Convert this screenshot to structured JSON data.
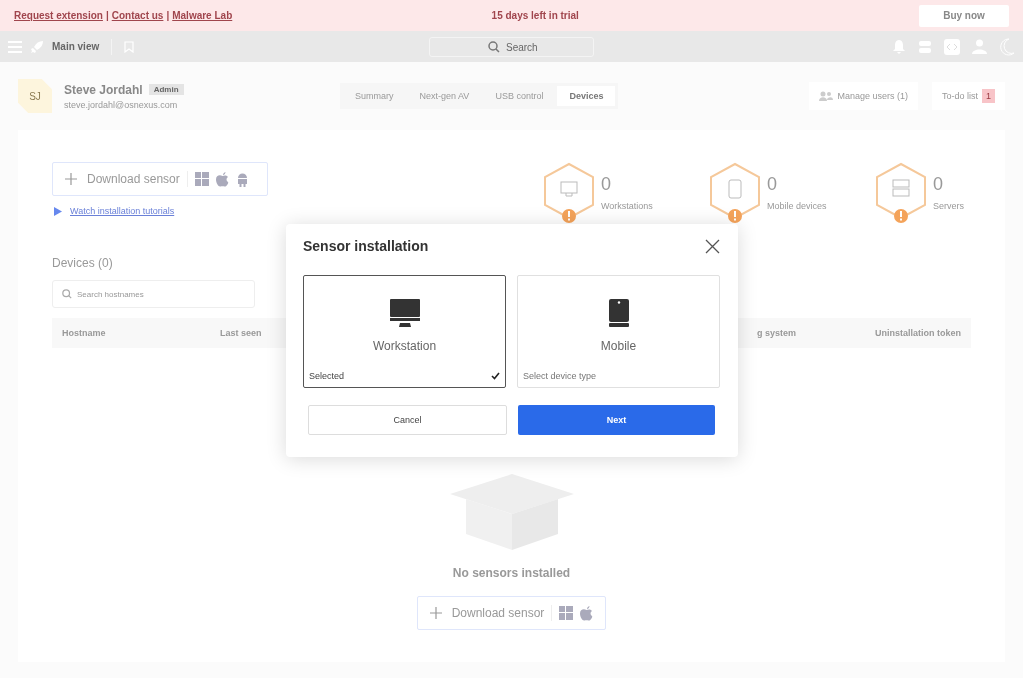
{
  "trial_banner": {
    "links": [
      "Request extension",
      "Contact us",
      "Malware Lab"
    ],
    "separator": "|",
    "message": "15 days left in trial",
    "buy_button": "Buy now"
  },
  "toolbar": {
    "view_label": "Main view",
    "search": {
      "placeholder": "Search"
    }
  },
  "user": {
    "initials": "SJ",
    "name": "Steve Jordahl",
    "role": "Admin",
    "email": "steve.jordahl@osnexus.com"
  },
  "tabs": [
    {
      "label": "Summary",
      "selected": false
    },
    {
      "label": "Next-gen AV",
      "selected": false
    },
    {
      "label": "USB control",
      "selected": false
    },
    {
      "label": "Devices",
      "selected": true
    }
  ],
  "manage_users": "Manage users (1)",
  "todo": {
    "label": "To-do list",
    "count": "1"
  },
  "download_button": "Download sensor",
  "tutorials_link": "Watch installation tutorials",
  "stats": [
    {
      "kind": "workstation",
      "value": "0",
      "label": "Workstations"
    },
    {
      "kind": "mobile",
      "value": "0",
      "label": "Mobile devices"
    },
    {
      "kind": "server",
      "value": "0",
      "label": "Servers"
    }
  ],
  "devices_heading": "Devices (0)",
  "hostname_search": {
    "placeholder": "Search hostnames"
  },
  "table": {
    "columns": [
      "Hostname",
      "Last seen",
      "g system",
      "Uninstallation token"
    ]
  },
  "empty_state": {
    "message": "No sensors installed",
    "button": "Download sensor"
  },
  "dialog": {
    "title": "Sensor installation",
    "options": [
      {
        "kind": "workstation",
        "label": "Workstation",
        "status": "Selected",
        "selected": true
      },
      {
        "kind": "mobile",
        "label": "Mobile",
        "status": "Select device type",
        "selected": false
      }
    ],
    "cancel": "Cancel",
    "next": "Next"
  }
}
